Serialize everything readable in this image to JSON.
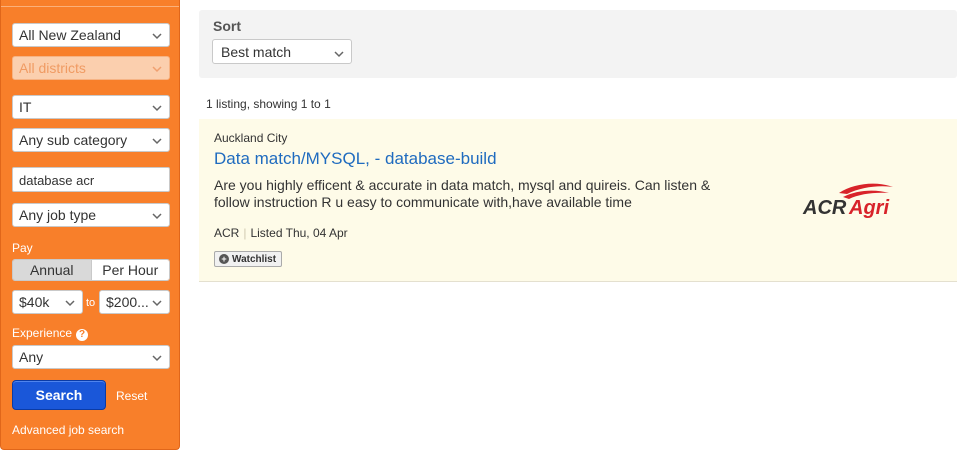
{
  "sidebar": {
    "region": "All New Zealand",
    "district": "All districts",
    "category": "IT",
    "sub_category": "Any sub category",
    "keywords": "database acr",
    "job_type": "Any job type",
    "pay_label": "Pay",
    "pay_annual": "Annual",
    "pay_per_hour": "Per Hour",
    "pay_min": "$40k",
    "pay_to": "to",
    "pay_max": "$200...",
    "experience_label": "Experience",
    "experience_help": "?",
    "experience": "Any",
    "search_button": "Search",
    "reset_link": "Reset",
    "advanced_link": "Advanced job search"
  },
  "sort": {
    "label": "Sort",
    "selected": "Best match"
  },
  "results": {
    "count_text": "1 listing, showing 1 to 1"
  },
  "listing": {
    "location": "Auckland City",
    "title": "Data match/MYSQL, - database-build",
    "description": "Are you highly efficent & accurate in data match, mysql and quireis. Can listen & follow instruction R u easy to communicate with,have available time",
    "company": "ACR",
    "listed": "Listed Thu, 04 Apr",
    "watchlist": "Watchlist",
    "logo_text_a": "ACR",
    "logo_text_b": "Agri"
  },
  "colors": {
    "sidebar_bg": "#f87f2a",
    "link_blue": "#1f6bbf",
    "search_button": "#1a57d9",
    "card_bg": "#fefbe8",
    "logo_red": "#d8232a"
  }
}
